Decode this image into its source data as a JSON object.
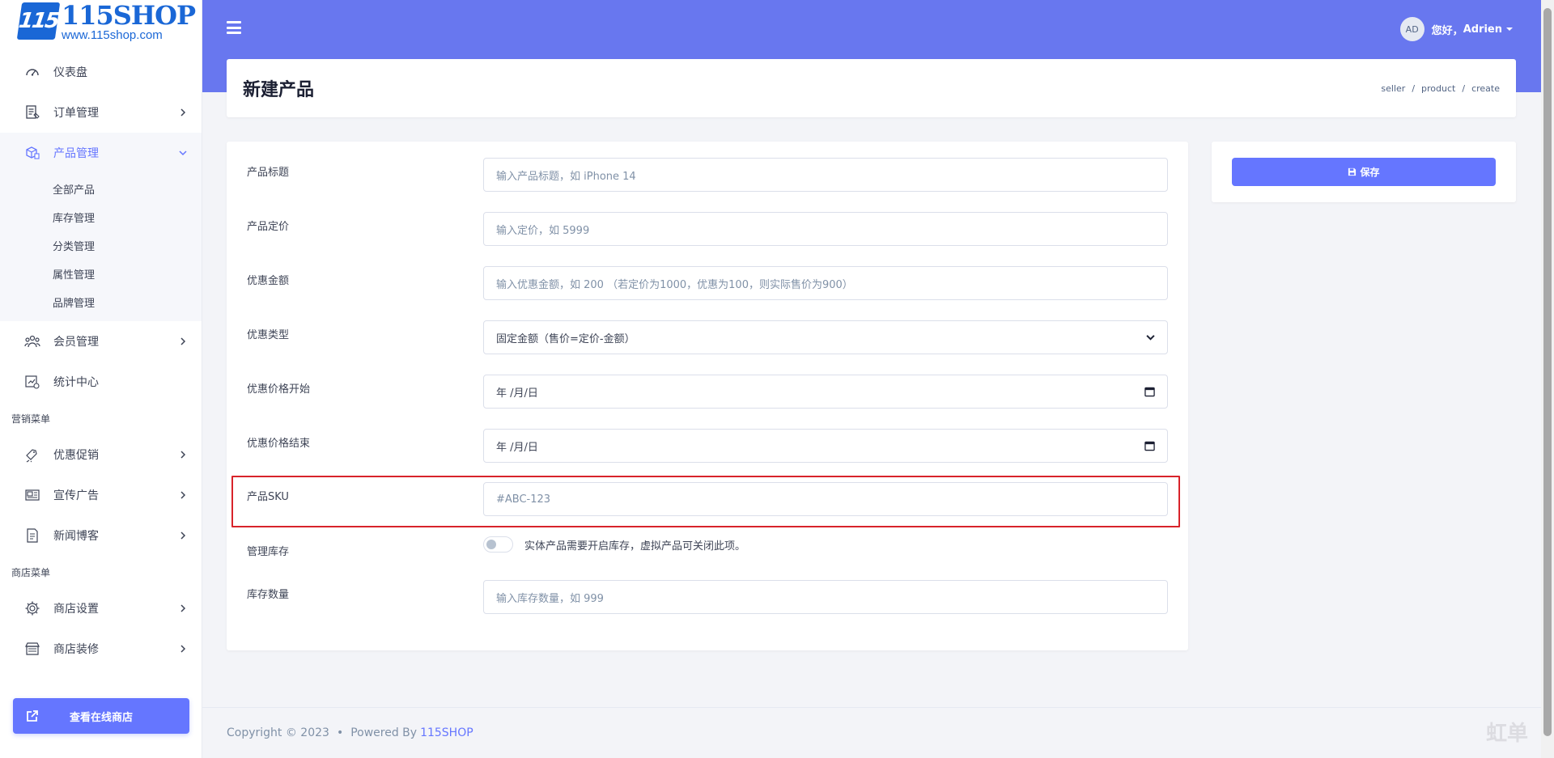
{
  "brand": {
    "name": "115SHOP",
    "url": "www.115shop.com",
    "logo_mark": "115",
    "color": "#1a67d6"
  },
  "sidebar": {
    "items": [
      {
        "label": "仪表盘",
        "icon": "dashboard-icon"
      },
      {
        "label": "订单管理",
        "icon": "order-list-icon"
      },
      {
        "label": "产品管理",
        "icon": "product-box-icon",
        "active": true,
        "children": [
          "全部产品",
          "库存管理",
          "分类管理",
          "属性管理",
          "品牌管理"
        ]
      },
      {
        "label": "会员管理",
        "icon": "users-icon"
      },
      {
        "label": "统计中心",
        "icon": "stats-icon"
      }
    ],
    "marketing_title": "营销菜单",
    "marketing_items": [
      {
        "label": "优惠促销",
        "icon": "promo-icon"
      },
      {
        "label": "宣传广告",
        "icon": "ad-icon"
      },
      {
        "label": "新闻博客",
        "icon": "blog-icon"
      }
    ],
    "store_title": "商店菜单",
    "store_items": [
      {
        "label": "商店设置",
        "icon": "gear-icon"
      },
      {
        "label": "商店装修",
        "icon": "store-decor-icon"
      }
    ],
    "store_button": "查看在线商店"
  },
  "header": {
    "greeting": "您好，",
    "username": "Adrien",
    "avatar_initials": "AD",
    "bg_color": "#6877ef"
  },
  "page": {
    "title": "新建产品",
    "breadcrumb": [
      "seller",
      "product",
      "create"
    ]
  },
  "form": {
    "title": {
      "label": "产品标题",
      "placeholder": "输入产品标题，如 iPhone 14"
    },
    "price": {
      "label": "产品定价",
      "placeholder": "输入定价，如 5999"
    },
    "discount": {
      "label": "优惠金额",
      "placeholder": "输入优惠金额，如 200 （若定价为1000，优惠为100，则实际售价为900）"
    },
    "discount_type": {
      "label": "优惠类型",
      "value": "固定金额（售价=定价-金额）"
    },
    "discount_start": {
      "label": "优惠价格开始",
      "value": "年 /月/日"
    },
    "discount_end": {
      "label": "优惠价格结束",
      "value": "年 /月/日"
    },
    "sku": {
      "label": "产品SKU",
      "placeholder": "#ABC-123"
    },
    "manage_stock": {
      "label": "管理库存",
      "hint": "实体产品需要开启库存，虚拟产品可关闭此项。",
      "enabled": false
    },
    "stock_qty": {
      "label": "库存数量",
      "placeholder": "输入库存数量，如 999"
    }
  },
  "actions": {
    "save_label": "保存"
  },
  "footer": {
    "copyright": "Copyright © 2023",
    "dot": "•",
    "powered": "Powered By",
    "link": "115SHOP"
  },
  "watermark": "虹单",
  "accent_color": "#6576ff",
  "highlight_color": "#d8232a"
}
